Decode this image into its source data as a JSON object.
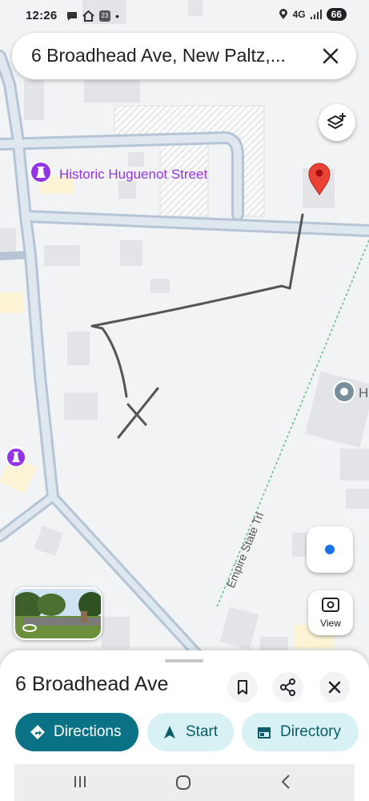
{
  "status_bar": {
    "time": "12:26",
    "notif_badge": "23",
    "dot": "•",
    "network": "4G",
    "battery": "66"
  },
  "search": {
    "query": "6 Broadhead Ave, New Paltz,..."
  },
  "map": {
    "poi_label": "Historic Huguenot Street",
    "poi_partial": "H",
    "trail_label": "Empire State Trl",
    "accent_color": "#9334e6",
    "pin_color": "#ea4335"
  },
  "view_button": {
    "label": "View"
  },
  "place_sheet": {
    "title": "6 Broadhead Ave",
    "actions": {
      "directions": "Directions",
      "start": "Start",
      "directory": "Directory"
    }
  }
}
